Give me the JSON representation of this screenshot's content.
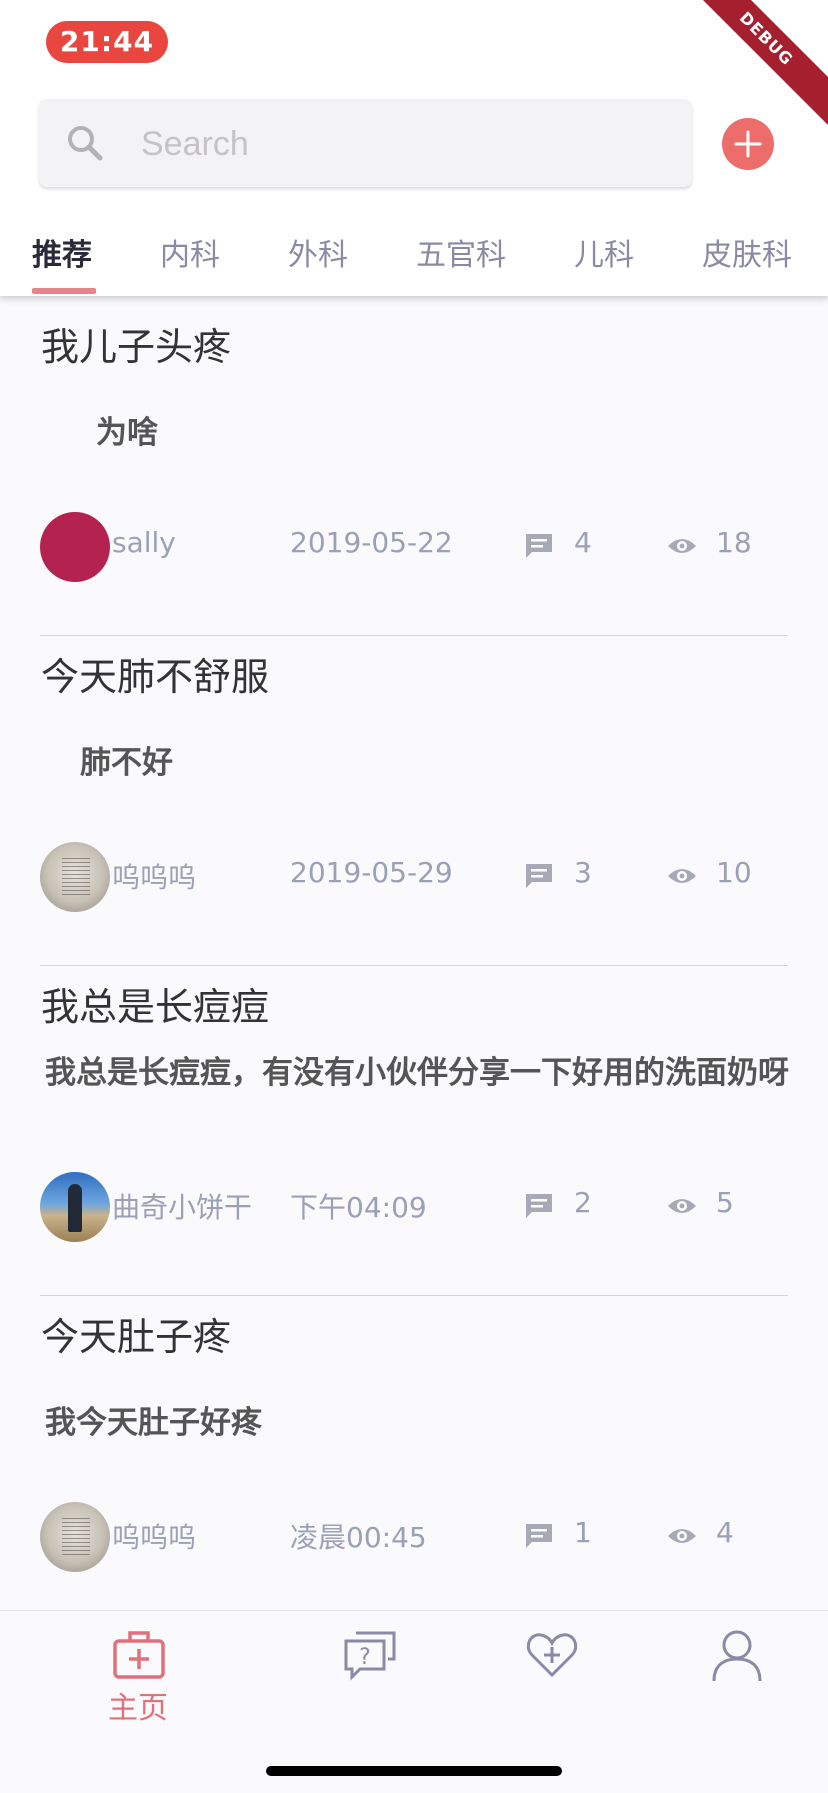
{
  "status_bar": {
    "time": "21:44"
  },
  "debug_banner": "DEBUG",
  "search": {
    "placeholder": "Search"
  },
  "tabs": [
    {
      "label": "推荐",
      "active": true
    },
    {
      "label": "内科",
      "active": false
    },
    {
      "label": "外科",
      "active": false
    },
    {
      "label": "五官科",
      "active": false
    },
    {
      "label": "儿科",
      "active": false
    },
    {
      "label": "皮肤科",
      "active": false
    }
  ],
  "posts": [
    {
      "title": "我儿子头疼",
      "body": "为啥",
      "author": "sally",
      "date": "2019-05-22",
      "comments": "4",
      "views": "18",
      "avatar": "magenta-circle"
    },
    {
      "title": "今天肺不舒服",
      "body": "肺不好",
      "author": "呜呜呜",
      "date": "2019-05-29",
      "comments": "3",
      "views": "10",
      "avatar": "paper-photo"
    },
    {
      "title": "我总是长痘痘",
      "body": "我总是长痘痘，有没有小伙伴分享一下好用的洗面奶呀",
      "author": "曲奇小饼干",
      "date": "下午04:09",
      "comments": "2",
      "views": "5",
      "avatar": "person-photo"
    },
    {
      "title": "今天肚子疼",
      "body": "我今天肚子好疼",
      "author": "呜呜呜",
      "date": "凌晨00:45",
      "comments": "1",
      "views": "4",
      "avatar": "paper-photo"
    }
  ],
  "bottom_nav": [
    {
      "label": "主页",
      "icon": "medical-kit-icon",
      "active": true
    },
    {
      "label": "",
      "icon": "question-chat-icon",
      "active": false
    },
    {
      "label": "",
      "icon": "heart-plus-icon",
      "active": false
    },
    {
      "label": "",
      "icon": "user-icon",
      "active": false
    }
  ],
  "colors": {
    "accent": "#ec6d6a",
    "time_pill": "#e8463f",
    "tab_indicator": "#e9838a",
    "meta_text": "#9aa0b5",
    "nav_inactive": "#8a8aa6"
  }
}
